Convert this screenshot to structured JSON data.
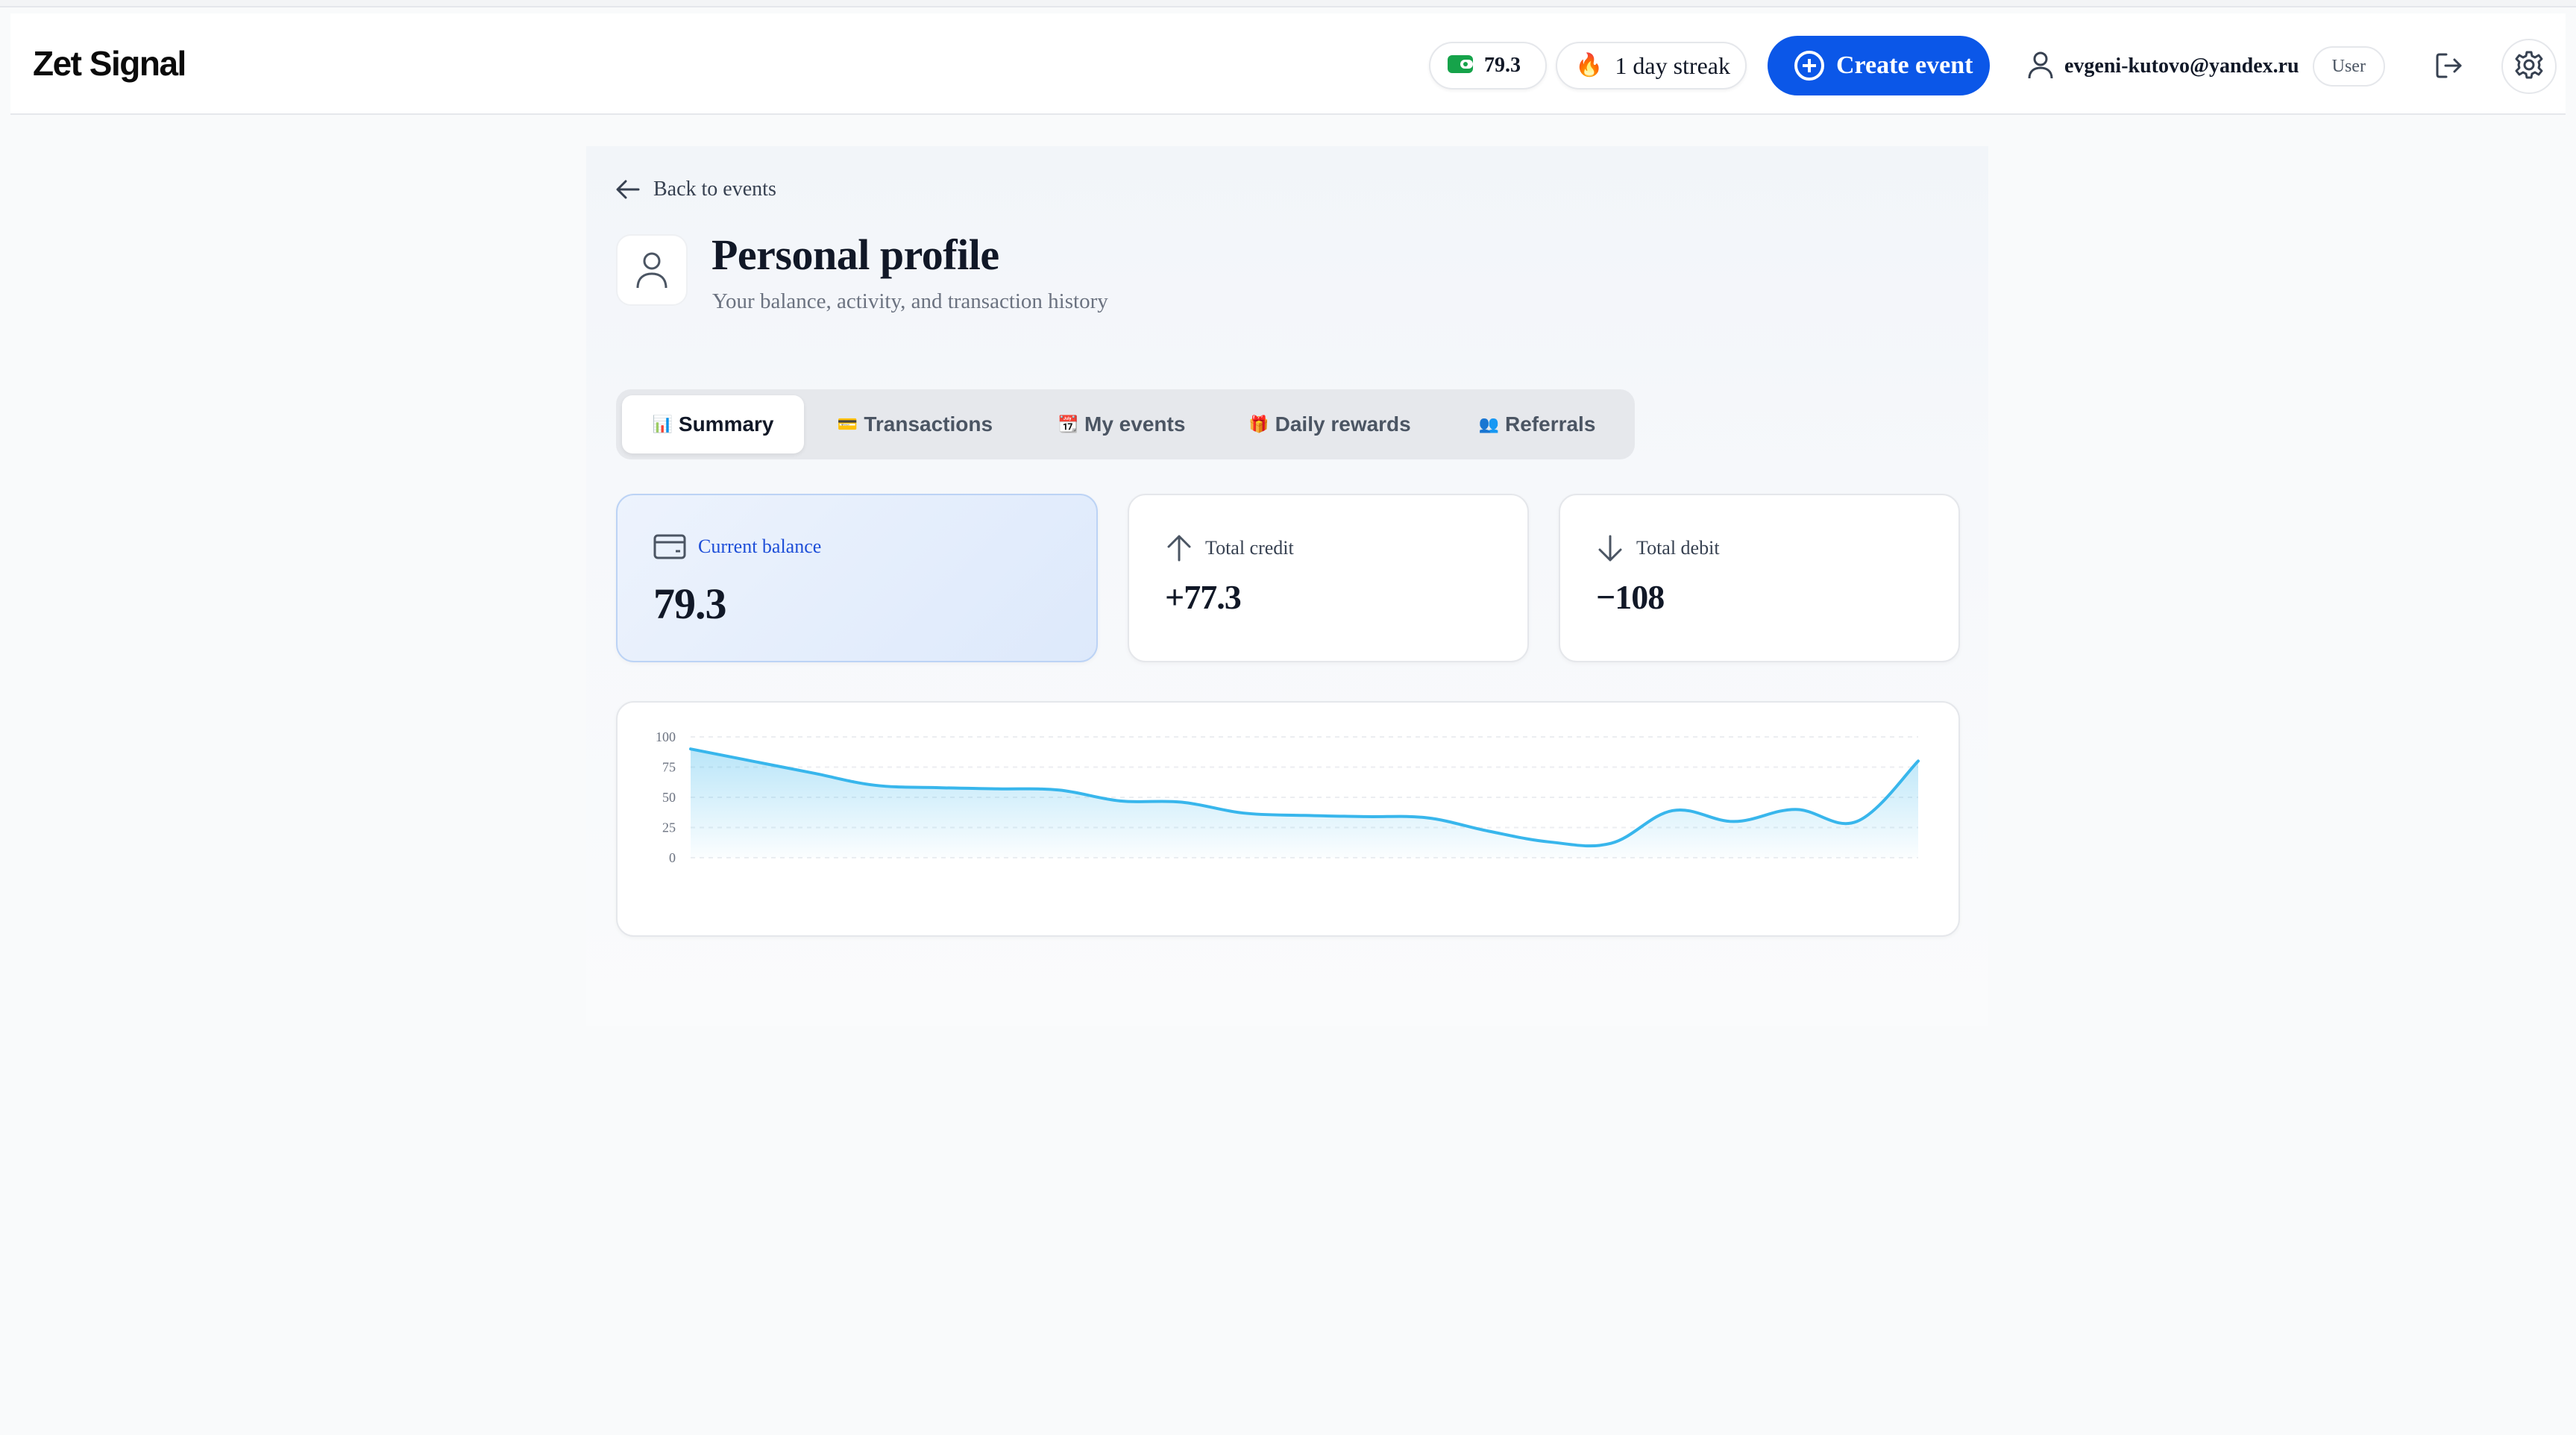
{
  "header": {
    "logo": "Zet Signal",
    "balance": "79.3",
    "streak": "1 day streak",
    "create_event": "Create event",
    "user_email": "evgeni-kutovo@yandex.ru",
    "user_role": "User"
  },
  "page": {
    "back_link": "Back to events",
    "title": "Personal profile",
    "subtitle": "Your balance, activity, and transaction history"
  },
  "tabs": [
    {
      "emoji": "📊",
      "label": "Summary",
      "active": true
    },
    {
      "emoji": "💳",
      "label": "Transactions",
      "active": false
    },
    {
      "emoji": "📆",
      "label": "My events",
      "active": false
    },
    {
      "emoji": "🎁",
      "label": "Daily rewards",
      "active": false
    },
    {
      "emoji": "👥",
      "label": "Referrals",
      "active": false
    }
  ],
  "cards": {
    "balance": {
      "label": "Current balance",
      "value": "79.3"
    },
    "credit": {
      "label": "Total credit",
      "value": "+77.3"
    },
    "debit": {
      "label": "Total debit",
      "value": "−108"
    }
  },
  "colors": {
    "accent": "#0b57e8",
    "chart_line": "#38b6ec",
    "balance_icon": "#16a34a"
  },
  "chart_data": {
    "type": "area",
    "title": "",
    "xlabel": "",
    "ylabel": "",
    "ylim": [
      0,
      100
    ],
    "yticks": [
      0,
      25,
      50,
      75,
      100
    ],
    "grid": true,
    "legend": "none",
    "x": [
      0,
      1,
      2,
      3,
      4,
      5,
      6,
      7,
      8,
      9,
      10,
      11,
      12,
      13,
      14,
      15,
      16,
      17,
      18,
      19,
      20
    ],
    "values": [
      90,
      80,
      70,
      60,
      58,
      57,
      56,
      47,
      46,
      37,
      35,
      34,
      33,
      22,
      13,
      12,
      39,
      30,
      40,
      30,
      80
    ]
  }
}
